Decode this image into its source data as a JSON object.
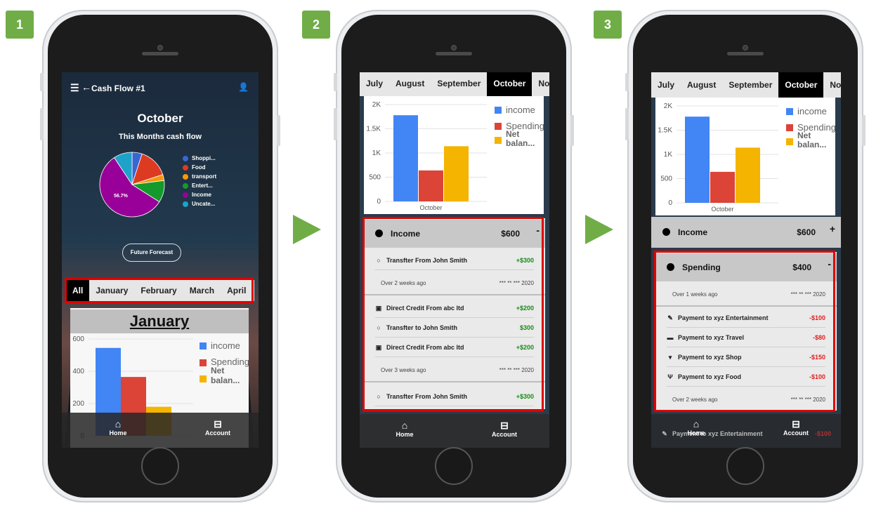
{
  "steps": [
    "1",
    "2",
    "3"
  ],
  "nav": {
    "home": "Home",
    "account": "Account"
  },
  "s1": {
    "header_title": "Cash Flow #1",
    "month": "October",
    "subtitle": "This Months cash flow",
    "pie_label": "56.7%",
    "legend": [
      {
        "label": "Shoppi...",
        "color": "#3a66d1"
      },
      {
        "label": "Food",
        "color": "#dc3b22"
      },
      {
        "label": "transport",
        "color": "#f59a0c"
      },
      {
        "label": "Entert...",
        "color": "#139a2b"
      },
      {
        "label": "Income",
        "color": "#990099"
      },
      {
        "label": "Uncate...",
        "color": "#1fa2c9"
      }
    ],
    "pie": [
      {
        "v": 5
      },
      {
        "v": 15
      },
      {
        "v": 3
      },
      {
        "v": 11
      },
      {
        "v": 56.7
      },
      {
        "v": 9.3
      }
    ],
    "forecast": "Future Forecast",
    "tabs": [
      "All",
      "January",
      "February",
      "March",
      "April"
    ],
    "active_tab": 0,
    "section_title": "January",
    "chart_legend": {
      "income": "income",
      "spending": "Spending",
      "net": "Net balan..."
    }
  },
  "tabs23": [
    "July",
    "August",
    "September",
    "October",
    "Nov"
  ],
  "active_month": 3,
  "chart_data": [
    {
      "type": "bar",
      "categories": [
        "January"
      ],
      "series": [
        {
          "name": "income",
          "values": [
            590
          ],
          "color": "#4285f4"
        },
        {
          "name": "Spending",
          "values": [
            395
          ],
          "color": "#db4437"
        },
        {
          "name": "Net balan...",
          "values": [
            195
          ],
          "color": "#f4b400"
        }
      ],
      "ylim": [
        0,
        650
      ],
      "yticks": [
        "600",
        "400",
        "200",
        "0"
      ]
    },
    {
      "type": "bar",
      "categories": [
        "October"
      ],
      "series": [
        {
          "name": "income",
          "values": [
            1780
          ],
          "color": "#4285f4"
        },
        {
          "name": "Spending",
          "values": [
            640
          ],
          "color": "#db4437"
        },
        {
          "name": "Net balan...",
          "values": [
            1140
          ],
          "color": "#f4b400"
        }
      ],
      "ylim": [
        0,
        2000
      ],
      "yticks": [
        "2K",
        "1.5K",
        "1K",
        "500",
        "0"
      ]
    }
  ],
  "s2": {
    "income_label": "Income",
    "income_amt": "$600",
    "toggle": "-",
    "rows": [
      {
        "icon": "circle",
        "desc": "Transfter From John Smith",
        "amt": "+$300"
      },
      {
        "meta_l": "Over 2 weeks ago",
        "meta_r": "*** ** *** 2020"
      },
      {
        "icon": "cash",
        "desc": "Direct Credit From abc ltd",
        "amt": "+$200"
      },
      {
        "icon": "circle",
        "desc": "Transfter to John Smith",
        "amt": "$300"
      },
      {
        "icon": "cash",
        "desc": "Direct Credit From abc ltd",
        "amt": "+$200"
      },
      {
        "meta_l": "Over 3 weeks ago",
        "meta_r": "*** ** *** 2020"
      },
      {
        "icon": "circle",
        "desc": "Transfter From John Smith",
        "amt": "+$300"
      }
    ]
  },
  "s3": {
    "income_label": "Income",
    "income_amt": "$600",
    "income_toggle": "+",
    "spending_label": "Spending",
    "spending_amt": "$400",
    "spending_toggle": "-",
    "meta1_l": "Over 1 weeks ago",
    "meta1_r": "*** ** *** 2020",
    "rows": [
      {
        "icon": "ticket",
        "desc": "Payment to xyz Entertainment",
        "amt": "-$100"
      },
      {
        "icon": "car",
        "desc": "Payment to xyz Travel",
        "amt": "-$80"
      },
      {
        "icon": "cart",
        "desc": "Payment to xyz Shop",
        "amt": "-$150"
      },
      {
        "icon": "food",
        "desc": "Payment to xyz Food",
        "amt": "-$100"
      }
    ],
    "meta2_l": "Over 2 weeks ago",
    "meta2_r": "*** ** *** 2020",
    "peek": {
      "desc": "Payment to xyz Entertainment",
      "amt": "-$100"
    }
  }
}
